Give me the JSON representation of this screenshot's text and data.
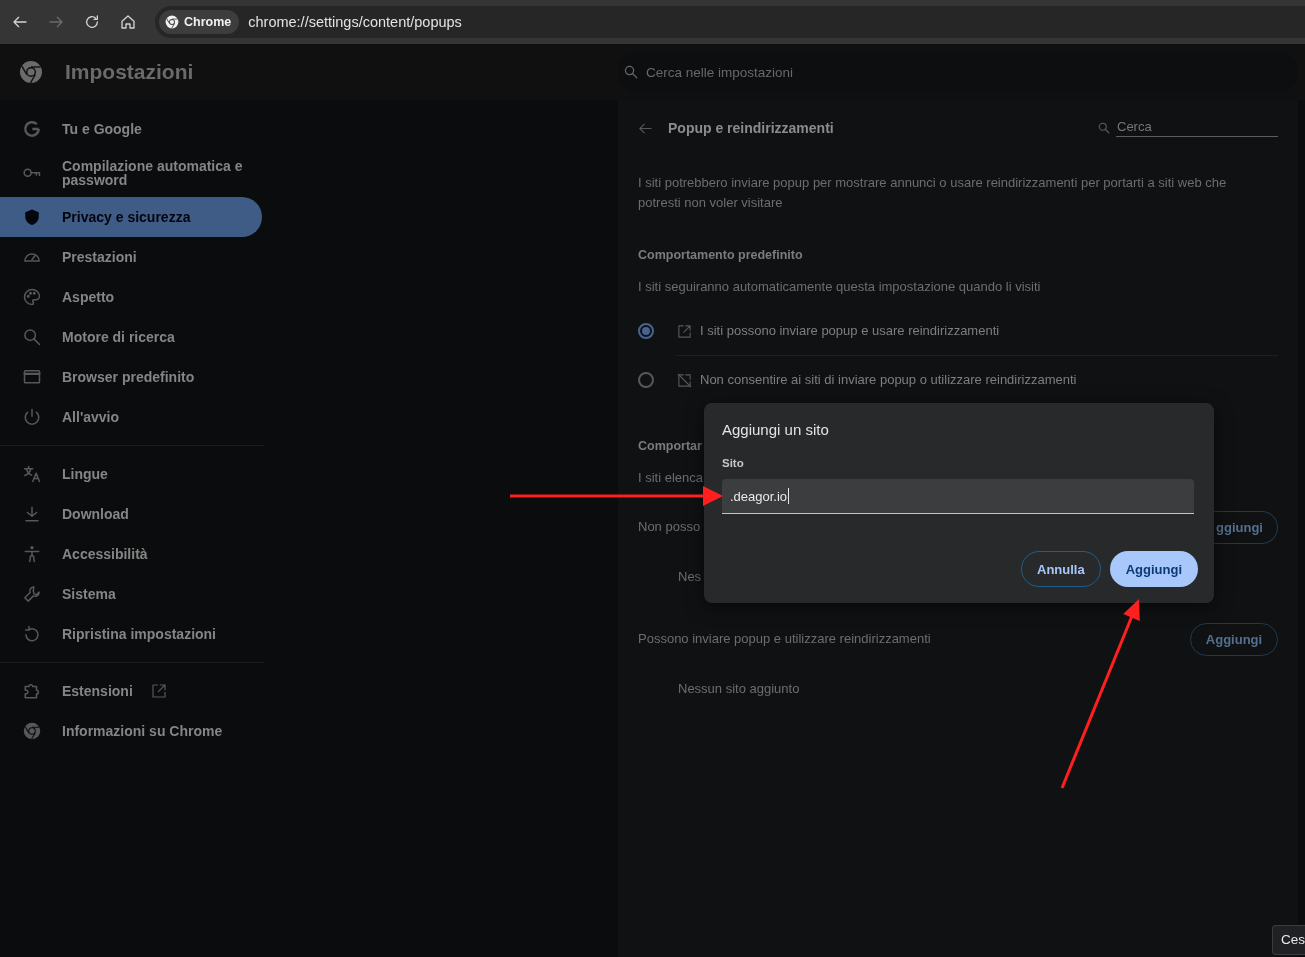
{
  "toolbar": {
    "nav_buttons": [
      {
        "kind": "back",
        "disabled": false
      },
      {
        "kind": "forward",
        "disabled": true
      },
      {
        "kind": "reload",
        "disabled": false
      },
      {
        "kind": "home",
        "disabled": false
      }
    ],
    "site_chip": "Chrome",
    "url": "chrome://settings/content/popups"
  },
  "header": {
    "title": "Impostazioni",
    "search": {
      "placeholder": "Cerca nelle impostazioni"
    }
  },
  "sidebar": {
    "groups": [
      {
        "items": [
          {
            "label": "Tu e Google",
            "selected": false,
            "external": false
          },
          {
            "label": "Compilazione automatica e password",
            "selected": false,
            "external": false
          },
          {
            "label": "Privacy e sicurezza",
            "selected": true,
            "external": false
          },
          {
            "label": "Prestazioni",
            "selected": false,
            "external": false
          },
          {
            "label": "Aspetto",
            "selected": false,
            "external": false
          },
          {
            "label": "Motore di ricerca",
            "selected": false,
            "external": false
          },
          {
            "label": "Browser predefinito",
            "selected": false,
            "external": false
          },
          {
            "label": "All'avvio",
            "selected": false,
            "external": false
          }
        ]
      },
      {
        "items": [
          {
            "label": "Lingue",
            "selected": false,
            "external": false
          },
          {
            "label": "Download",
            "selected": false,
            "external": false
          },
          {
            "label": "Accessibilità",
            "selected": false,
            "external": false
          },
          {
            "label": "Sistema",
            "selected": false,
            "external": false
          },
          {
            "label": "Ripristina impostazioni",
            "selected": false,
            "external": false
          }
        ]
      },
      {
        "items": [
          {
            "label": "Estensioni",
            "selected": false,
            "external": true
          },
          {
            "label": "Informazioni su Chrome",
            "selected": false,
            "external": false
          }
        ]
      }
    ]
  },
  "panel": {
    "title": "Popup e reindirizzamenti",
    "search": {
      "placeholder": "Cerca"
    },
    "description": "I siti potrebbero inviare popup per mostrare annunci o usare reindirizzamenti per portarti a siti web che potresti non voler visitare",
    "default_behavior": {
      "heading": "Comportamento predefinito",
      "subtitle": "I siti seguiranno automaticamente questa impostazione quando li visiti",
      "options": [
        {
          "label": "I siti possono inviare popup e usare reindirizzamenti",
          "selected": true
        },
        {
          "label": "Non consentire ai siti di inviare popup o utilizzare reindirizzamenti",
          "selected": false
        }
      ]
    },
    "custom_behavior": {
      "heading": "Comportar",
      "subtitle": "I siti elenca",
      "lists": [
        {
          "heading": "Non posso",
          "button": {
            "label": "ggiungi",
            "partly_hidden": true
          },
          "empty_text": "Nes"
        },
        {
          "heading": "Possono inviare popup e utilizzare reindirizzamenti",
          "button": {
            "label": "Aggiungi",
            "partly_hidden": false
          },
          "empty_text": "Nessun sito aggiunto"
        }
      ]
    }
  },
  "dialog": {
    "title": "Aggiungi un sito",
    "field": {
      "label": "Sito",
      "value": ".deagor.io",
      "focused": true
    },
    "buttons": [
      {
        "label": "Annulla",
        "kind": "secondary"
      },
      {
        "label": "Aggiungi",
        "kind": "primary"
      }
    ]
  },
  "tooltip": {
    "text": "Ces"
  }
}
